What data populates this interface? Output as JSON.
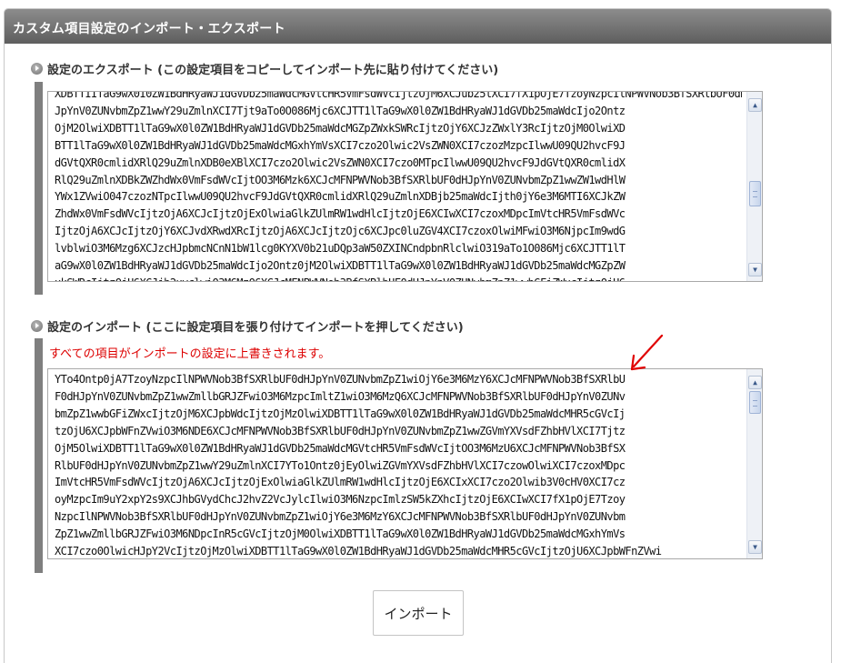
{
  "panel": {
    "title": "カスタム項目設定のインポート・エクスポート"
  },
  "export_section": {
    "heading": "設定のエクスポート (この設定項目をコピーしてインポート先に貼り付けてください)",
    "text": "XDBTTIITaG9wX0I0ZW1BdHRyaWJ1dGVDb25maWdcMGVtcHR5VmFsdWVcIjtzOjM6XCJub25lXCI7fX1pOjE7TzoyNzpcIlNPWVNob3BfSXRlbUF0dHJpYnV0ZUNvbmZpZ1wiOjY6e3M6MzY6XCJcMFNP\nJpYnV0ZUNvbmZpZ1wwY29uZmlnXCI7Tjt9aTo0O086Mjc6XCJTT1lTaG9wX0l0ZW1BdHRyaWJ1dGVDb25maWdcIjo2Ontz\nOjM2OlwiXDBTT1lTaG9wX0l0ZW1BdHRyaWJ1dGVDb25maWdcMGZpZWxkSWRcIjtzOjY6XCJzZWxlY3RcIjtzOjM0OlwiXD\nBTT1lTaG9wX0l0ZW1BdHRyaWJ1dGVDb25maWdcMGxhYmVsXCI7czo2Olwic2VsZWN0XCI7czozMzpcIlwwU09QU2hvcF9J\ndGVtQXR0cmlidXRlQ29uZmlnXDB0eXBlXCI7czo2Olwic2VsZWN0XCI7czo0MTpcIlwwU09QU2hvcF9JdGVtQXR0cmlidX\nRlQ29uZmlnXDBkZWZhdWx0VmFsdWVcIjtOO3M6Mzk6XCJcMFNPWVNob3BfSXRlbUF0dHJpYnV0ZUNvbmZpZ1wwZW1wdHlW\nYWx1ZVwiO047czozNTpcIlwwU09QU2hvcF9JdGVtQXR0cmlidXRlQ29uZmlnXDBjb25maWdcIjth0jY6e3M6MTI6XCJkZW\nZhdWx0VmFsdWVcIjtzOjA6XCJcIjtzOjExOlwiaGlkZUlmRW1wdHlcIjtzOjE6XCIwXCI7czoxMDpcImVtcHR5VmFsdWVc\nIjtzOjA6XCJcIjtzOjY6XCJvdXRwdXRcIjtzOjA6XCJcIjtzOjc6XCJpc0luZGV4XCI7czoxOlwiMFwiO3M6NjpcIm9wdG\nlvblwiO3M6Mzg6XCJzcHJpbmcNCnN1bW1lcg0KYXV0b21uDQp3aW50ZXINCndpbnRlclwiO319aTo1O086Mjc6XCJTT1lT\naG9wX0l0ZW1BdHRyaWJ1dGVDb25maWdcIjo2Ontz0jM2OlwiXDBTT1lTaG9wX0l0ZW1BdHRyaWJ1dGVDb25maWdcMGZpZW\nxkSWRcIjtzOjU6XCJjb2xvclwiO3M6MzQ6XCJcMFNPWVNob3BfSXRlbUF0dHJpYnV0ZUNvbmZpZ1wwbGFiZWxcIjtzOjU6"
  },
  "import_section": {
    "heading": "設定のインポート (ここに設定項目を張り付けてインポートを押してください)",
    "warning": "すべての項目がインポートの設定に上書きされます。",
    "text": "YTo4Ontp0jA7TzoyNzpcIlNPWVNob3BfSXRlbUF0dHJpYnV0ZUNvbmZpZ1wiOjY6e3M6MzY6XCJcMFNPWVNob3BfSXRlbU\nF0dHJpYnV0ZUNvbmZpZ1wwZmllbGRJZFwiO3M6MzpcImltZ1wiO3M6MzQ6XCJcMFNPWVNob3BfSXRlbUF0dHJpYnV0ZUNv\nbmZpZ1wwbGFiZWxcIjtzOjM6XCJpbWdcIjtzOjMzOlwiXDBTT1lTaG9wX0l0ZW1BdHRyaWJ1dGVDb25maWdcMHR5cGVcIj\ntzOjU6XCJpbWFnZVwiO3M6NDE6XCJcMFNPWVNob3BfSXRlbUF0dHJpYnV0ZUNvbmZpZ1wwZGVmYXVsdFZhbHVlXCI7Tjtz\nOjM5OlwiXDBTT1lTaG9wX0l0ZW1BdHRyaWJ1dGVDb25maWdcMGVtcHR5VmFsdWVcIjtOO3M6MzU6XCJcMFNPWVNob3BfSX\nRlbUF0dHJpYnV0ZUNvbmZpZ1wwY29uZmlnXCI7YTo1Ontz0jEyOlwiZGVmYXVsdFZhbHVlXCI7czowOlwiXCI7czoxMDpc\nImVtcHR5VmFsdWVcIjtzOjA6XCJcIjtzOjExOlwiaGlkZUlmRW1wdHlcIjtzOjE6XCIxXCI7czo2Olwib3V0cHV0XCI7cz\noyMzpcIm9uY2xpY2s9XCJhbGVydChcJ2hvZ2VcJylcIlwiO3M6NzpcImlzSW5kZXhcIjtzOjE6XCIwXCI7fX1pOjE7Tzoy\nNzpcIlNPWVNob3BfSXRlbUF0dHJpYnV0ZUNvbmZpZ1wiOjY6e3M6MzY6XCJcMFNPWVNob3BfSXRlbUF0dHJpYnV0ZUNvbm\nZpZ1wwZmllbGRJZFwiO3M6NDpcInR5cGVcIjtzOjM0OlwiXDBTT1lTaG9wX0l0ZW1BdHRyaWJ1dGVDb25maWdcMGxhYmVs\nXCI7czo0OlwicHJpY2VcIjtzOjMzOlwiXDBTT1lTaG9wX0l0ZW1BdHRyaWJ1dGVDb25maWdcMHR5cGVcIjtzOjU6XCJpbWFnZVwi"
  },
  "buttons": {
    "import_label": "インポート"
  },
  "icons": {
    "bullet": "circle-arrow-bullet-icon",
    "scroll_up": "scroll-up-arrow-icon",
    "scroll_down": "scroll-down-arrow-icon",
    "annotation_arrow": "red-arrow-icon"
  },
  "colors": {
    "title_bar": "#6e6e6e",
    "warning_text": "#dd0000",
    "annotation_arrow": "#e00000"
  }
}
